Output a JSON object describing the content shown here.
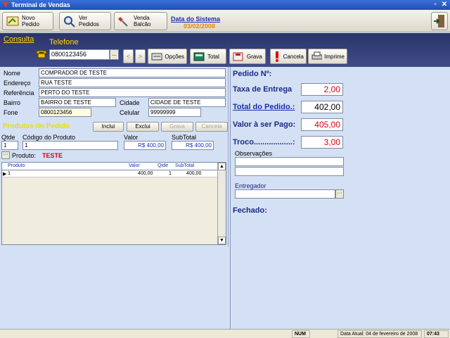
{
  "window": {
    "title": "Terminal de Vendas"
  },
  "toolbar": {
    "novo_pedido": "Novo Pedido",
    "ver_pedidos": "Ver Pedidos",
    "venda_balcao": "Venda Balcão",
    "sysdate_label": "Data do Sistema",
    "sysdate": "03/02/2008"
  },
  "search": {
    "consulta": "Consulta",
    "telefone_label": "Telefone",
    "telefone_value": "0800123456",
    "dots": "...",
    "prev": "<",
    "next": ">",
    "opcoes": "Opções",
    "total": "Total",
    "grava": "Grava",
    "cancela": "Cancela",
    "imprime": "Imprime"
  },
  "customer": {
    "nome_label": "Nome",
    "nome": "COMPRADOR DE TESTE",
    "endereco_label": "Endereço",
    "endereco": "RUA TESTE",
    "referencia_label": "Referência",
    "referencia": "PERTO DO TESTE",
    "bairro_label": "Bairro",
    "bairro": "BAIRRO DE TESTE",
    "cidade_label": "Cidade",
    "cidade": "CIDADE DE TESTE",
    "fone_label": "Fone",
    "fone": "0800123456",
    "celular_label": "Celular",
    "celular": "99999999"
  },
  "products": {
    "section_title": "Produtos do Pedido",
    "inclui": "Inclui",
    "exclui": "Exclui",
    "grava": "Grava",
    "cancela": "Cancela",
    "qtde_label": "Qtde",
    "codigo_label": "Código do Produto",
    "valor_label": "Valor",
    "subtotal_label": "SubTotal",
    "qtde": "1",
    "codigo": "1",
    "valor": "R$ 400,00",
    "subtotal": "R$ 400,00",
    "produto_label": "Produto:",
    "produto_name": "TESTE"
  },
  "grid": {
    "headers": {
      "produto": "Produto",
      "valor": "Valor",
      "qtde": "Qtde",
      "subtotal": "SubTotal"
    },
    "row": {
      "produto": "1",
      "valor": "400,00",
      "qtde": "1",
      "subtotal": "400,00"
    }
  },
  "order": {
    "pedido_label": "Pedido Nº:",
    "taxa_label": "Taxa de Entrega",
    "taxa": "2,00",
    "total_label": "Total do Pedido.:",
    "total": "402,00",
    "apagar_label": "Valor à ser Pago:",
    "apagar": "405,00",
    "troco_label": "Troco..................:",
    "troco": "3,00",
    "observacoes_label": "Observações",
    "entregador_label": "Entregador",
    "fechado_label": "Fechado:"
  },
  "statusbar": {
    "num": "NUM",
    "data_atual": "Data Atual: 04 de fevereiro de 2008",
    "time": "07:43"
  }
}
